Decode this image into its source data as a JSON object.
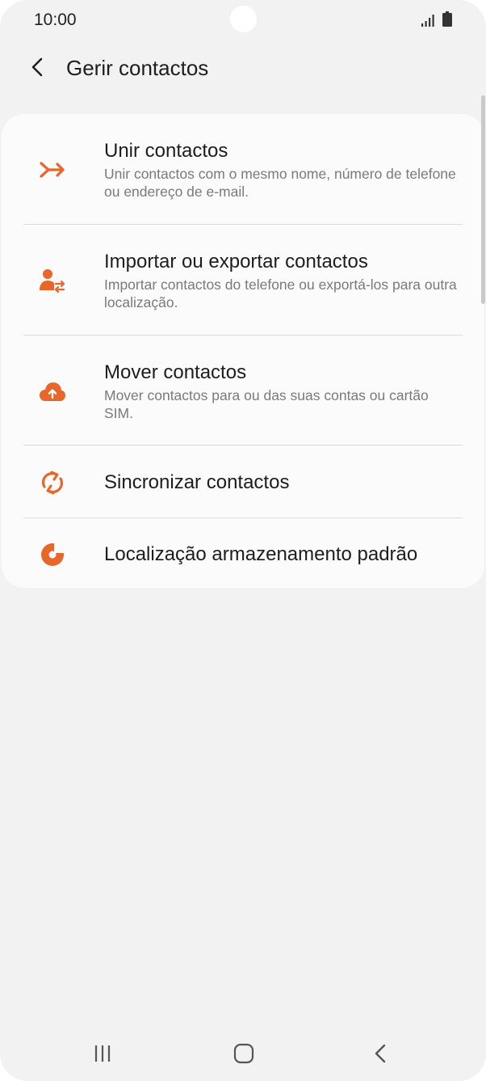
{
  "status_bar": {
    "time": "10:00"
  },
  "header": {
    "back_icon": "chevron-left-icon",
    "title": "Gerir contactos"
  },
  "accent_color": "#e8662a",
  "menu": {
    "items": [
      {
        "icon": "merge-arrow-icon",
        "title": "Unir contactos",
        "subtitle": "Unir contactos com o mesmo nome, número de telefone ou endereço de e-mail."
      },
      {
        "icon": "person-transfer-icon",
        "title": "Importar ou exportar contactos",
        "subtitle": "Importar contactos do telefone ou exportá-los para outra localização."
      },
      {
        "icon": "cloud-upload-icon",
        "title": "Mover contactos",
        "subtitle": "Mover contactos para ou das suas contas ou cartão SIM."
      },
      {
        "icon": "sync-icon",
        "title": "Sincronizar contactos"
      },
      {
        "icon": "pie-chart-icon",
        "title": "Localização armazenamento padrão"
      }
    ]
  },
  "nav_bar": {
    "items": [
      "recent-apps-icon",
      "home-icon",
      "back-icon"
    ]
  }
}
